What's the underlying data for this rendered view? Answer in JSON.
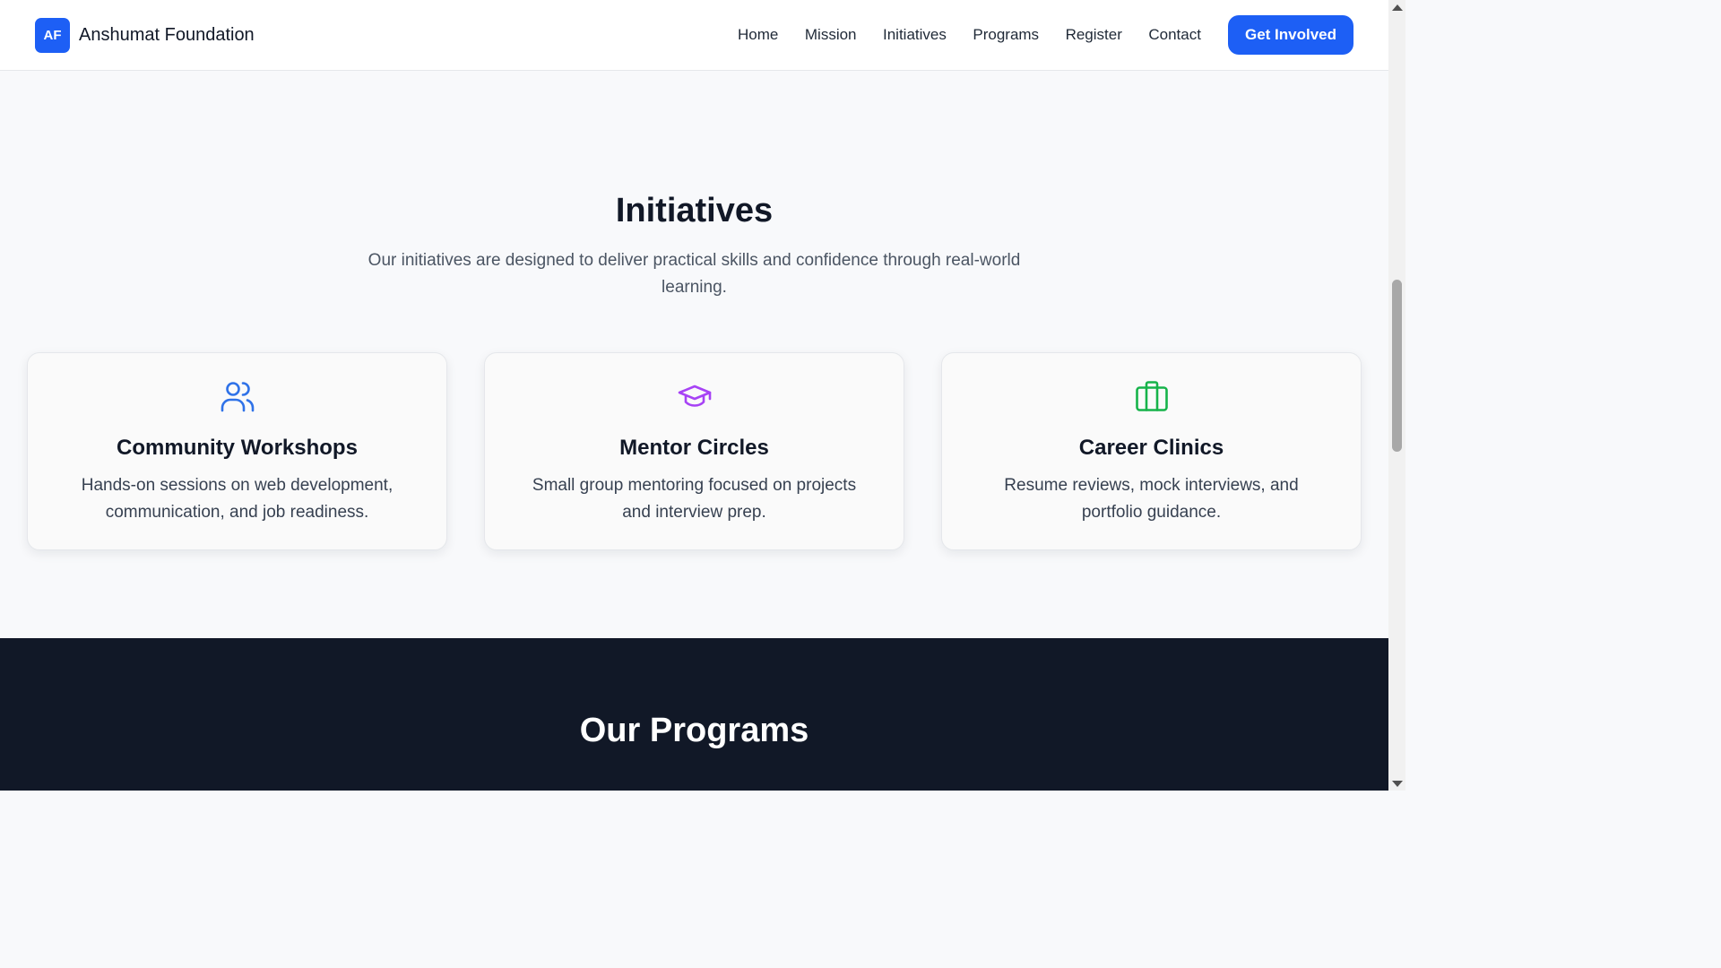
{
  "header": {
    "logo_text": "AF",
    "brand_name": "Anshumat Foundation",
    "nav": [
      "Home",
      "Mission",
      "Initiatives",
      "Programs",
      "Register",
      "Contact"
    ],
    "cta_label": "Get Involved"
  },
  "initiatives": {
    "title": "Initiatives",
    "subtitle": "Our initiatives are designed to deliver practical skills and confidence through real-world learning.",
    "cards": [
      {
        "icon": "users-icon",
        "icon_color": "#2f72e8",
        "title": "Community Workshops",
        "text": "Hands-on sessions on web development, communication, and job readiness."
      },
      {
        "icon": "graduation-cap-icon",
        "icon_color": "#a742f5",
        "title": "Mentor Circles",
        "text": "Small group mentoring focused on projects and interview prep."
      },
      {
        "icon": "briefcase-icon",
        "icon_color": "#16b34a",
        "title": "Career Clinics",
        "text": "Resume reviews, mock interviews, and portfolio guidance."
      }
    ]
  },
  "programs": {
    "title": "Our Programs"
  },
  "colors": {
    "accent": "#1d5ff5",
    "dark_section": "#111827",
    "page_bg": "#f8f9fb"
  }
}
